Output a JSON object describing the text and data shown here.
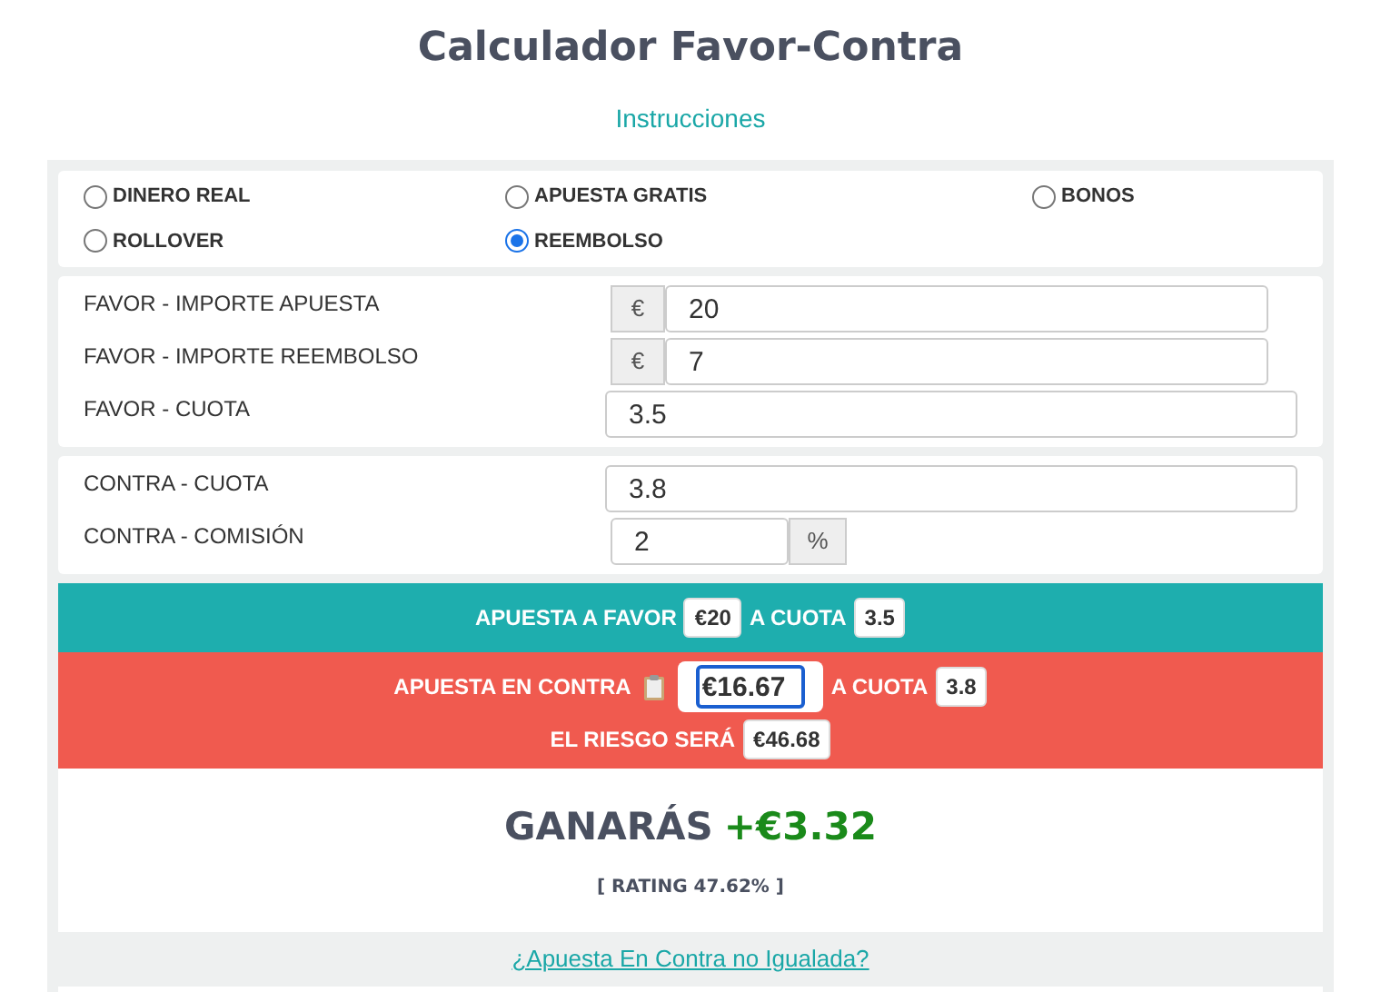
{
  "title": "Calculador Favor-Contra",
  "instructions_link": "Instrucciones",
  "bet_types": [
    {
      "label": "DINERO REAL",
      "selected": false
    },
    {
      "label": "APUESTA GRATIS",
      "selected": false
    },
    {
      "label": "BONOS",
      "selected": false
    },
    {
      "label": "ROLLOVER",
      "selected": false
    },
    {
      "label": "REEMBOLSO",
      "selected": true
    }
  ],
  "favor_fields": [
    {
      "label": "FAVOR - IMPORTE APUESTA",
      "kind": "prefixed",
      "addon": "€",
      "value": "20"
    },
    {
      "label": "FAVOR - IMPORTE REEMBOLSO",
      "kind": "prefixed",
      "addon": "€",
      "value": "7"
    },
    {
      "label": "FAVOR - CUOTA",
      "kind": "plain",
      "value": "3.5"
    }
  ],
  "contra_fields": [
    {
      "label": "CONTRA - CUOTA",
      "kind": "plain",
      "value": "3.8"
    },
    {
      "label": "CONTRA - COMISIÓN",
      "kind": "suffixed",
      "addon": "%",
      "value": "2"
    }
  ],
  "favor_result": {
    "label": "APUESTA A FAVOR",
    "amount": "€20",
    "odds_label": "A CUOTA",
    "odds": "3.5"
  },
  "contra_result": {
    "label": "APUESTA EN CONTRA",
    "amount": "€16.67",
    "odds_label": "A CUOTA",
    "odds": "3.8",
    "risk_label": "EL RIESGO SERÁ",
    "risk": "€46.68"
  },
  "winnings": {
    "label": "GANARÁS",
    "amount": "+€3.32",
    "rating": "[ RATING 47.62% ]"
  },
  "unmatched_link": "¿Apuesta En Contra no Igualada?"
}
